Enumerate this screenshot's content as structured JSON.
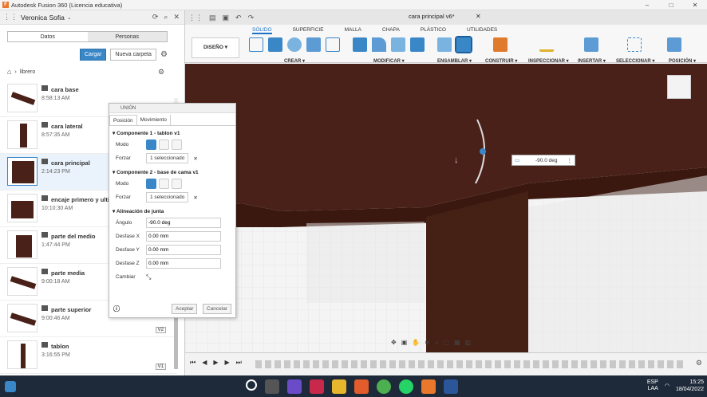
{
  "window": {
    "title": "Autodesk Fusion 360 (Licencia educativa)"
  },
  "left_panel": {
    "user": "Veronica Sofia",
    "tabs": [
      "Datos",
      "Personas"
    ],
    "upload_label": "Cargar",
    "new_folder_label": "Nueva carpeta",
    "folder": "librero",
    "files": [
      {
        "name": "cara base",
        "time": "8:58:13 AM"
      },
      {
        "name": "cara lateral",
        "time": "8:57:35 AM"
      },
      {
        "name": "cara principal",
        "time": "2:14:23 PM"
      },
      {
        "name": "encaje primero y ulti",
        "time": "10:10:30 AM"
      },
      {
        "name": "parte del medio",
        "time": "1:47:44 PM"
      },
      {
        "name": "parte media",
        "time": "9:00:18 AM"
      },
      {
        "name": "parte superior",
        "time": "9:00:46 AM",
        "version": "V2"
      },
      {
        "name": "tablon",
        "time": "3:16:55 PM",
        "version": "V1"
      }
    ]
  },
  "toolbar": {
    "doc_tab": "cara principal v6*",
    "ribbon_tabs": [
      "SÓLIDO",
      "SUPERFICIE",
      "MALLA",
      "CHAPA",
      "PLÁSTICO",
      "UTILIDADES"
    ],
    "workspace": "DISEÑO ▾",
    "groups": [
      "CREAR ▾",
      "MODIFICAR ▾",
      "ENSAMBLAR ▾",
      "CONSTRUIR ▾",
      "INSPECCIONAR ▾",
      "INSERTAR ▾",
      "SELECCIONAR ▾",
      "POSICIÓN ▾"
    ]
  },
  "dialog": {
    "title": "UNIÓN",
    "tabs": [
      "Posición",
      "Movimiento"
    ],
    "comp1": "Componente 1 - tablon v1",
    "comp2": "Componente 2 - base de cama v1",
    "mode_label": "Modo",
    "force_label": "Forzar",
    "selected": "1 seleccionado",
    "align_title": "Alineación de junta",
    "angle_label": "Ángulo",
    "angle_value": "-90.0 deg",
    "dx_label": "Desfase X",
    "dx_value": "0.00 mm",
    "dy_label": "Desfase Y",
    "dy_value": "0.00 mm",
    "dz_label": "Desfase Z",
    "dz_value": "0.00 mm",
    "change_label": "Cambiar",
    "accept": "Aceptar",
    "cancel": "Cancelar"
  },
  "viewport": {
    "angle_readout": "-90.0 deg"
  },
  "taskbar": {
    "lang1": "ESP",
    "lang2": "LAA",
    "time": "15:25",
    "date": "18/04/2022"
  },
  "colors": {
    "accent": "#3a87c8",
    "wood": "#4a2118"
  }
}
